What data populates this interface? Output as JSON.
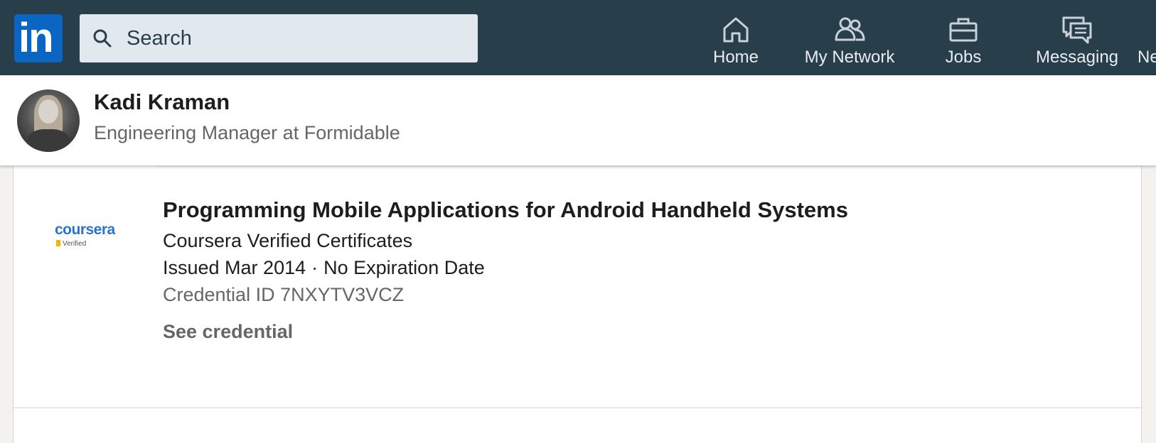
{
  "nav": {
    "logo_text": "in",
    "search_placeholder": "Search",
    "items": [
      {
        "label": "Home",
        "icon": "home-icon"
      },
      {
        "label": "My Network",
        "icon": "network-icon"
      },
      {
        "label": "Jobs",
        "icon": "briefcase-icon"
      },
      {
        "label": "Messaging",
        "icon": "messaging-icon"
      },
      {
        "label": "Ne",
        "icon": "notifications-icon"
      }
    ],
    "colors": {
      "bar": "#283e4a",
      "logo": "#0a66c2",
      "search_bg": "#e1e9ee"
    }
  },
  "profile": {
    "name": "Kadi Kraman",
    "headline": "Engineering Manager at Formidable"
  },
  "certification": {
    "org_logo_word": "coursera",
    "org_logo_badge": "Verified",
    "title": "Programming Mobile Applications for Android Handheld Systems",
    "issuer": "Coursera Verified Certificates",
    "issued": "Issued Mar 2014",
    "separator": "·",
    "expiration": "No Expiration Date",
    "credential_id": "Credential ID 7NXYTV3VCZ",
    "see_credential_label": "See credential"
  }
}
